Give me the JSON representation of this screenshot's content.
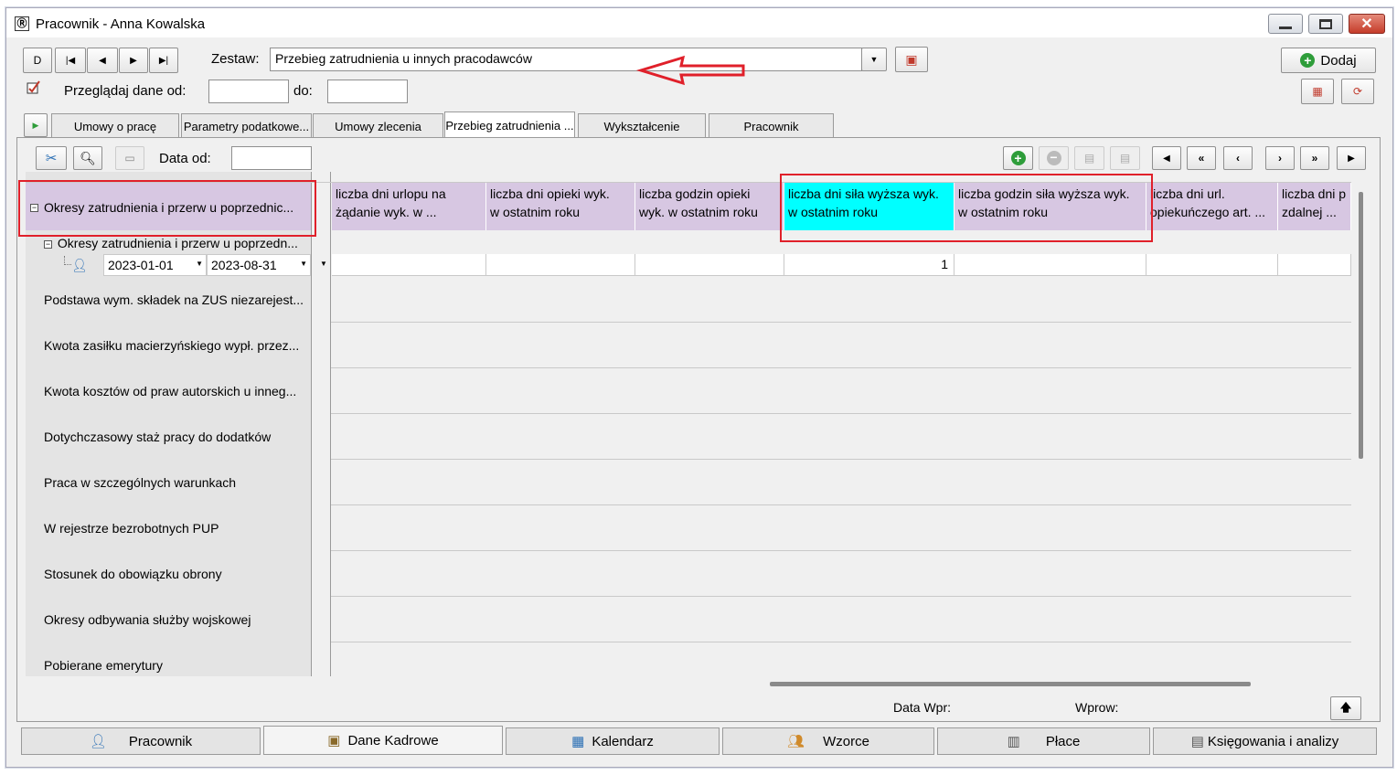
{
  "window": {
    "title": "Pracownik - Anna Kowalska"
  },
  "toolbar": {
    "nav_buttons": [
      "D",
      "|◀",
      "◀",
      "▶",
      "▶|"
    ],
    "zestaw_label": "Zestaw:",
    "zestaw_value": "Przebieg zatrudnienia u innych pracodawców",
    "add_label": "Dodaj",
    "browse_label": "Przeglądaj dane od:",
    "do_label": "do:"
  },
  "tabs": [
    "Umowy o pracę",
    "Parametry podatkowe...",
    "Umowy zlecenia",
    "Przebieg zatrudnienia ...",
    "Wykształcenie",
    "Pracownik"
  ],
  "active_tab": "Przebieg zatrudnienia ...",
  "grid": {
    "data_od_label": "Data od:",
    "group_header": "Okresy zatrudnienia i przerw u poprzednic...",
    "subgroup": "Okresy zatrudnienia i przerw u poprzedn...",
    "date_from": "2023-01-01",
    "date_to": "2023-08-31",
    "columns": [
      {
        "line1": "liczba dni urlopu na",
        "line2": "żądanie wyk. w ..."
      },
      {
        "line1": "liczba dni opieki wyk.",
        "line2": "w ostatnim roku"
      },
      {
        "line1": "liczba godzin opieki",
        "line2": "wyk. w ostatnim roku"
      },
      {
        "line1": "liczba dni siła wyższa wyk.",
        "line2": "w ostatnim roku"
      },
      {
        "line1": "liczba godzin siła wyższa wyk.",
        "line2": "w ostatnim roku"
      },
      {
        "line1": "liczba dni url.",
        "line2": "opiekuńczego art. ..."
      },
      {
        "line1": "liczba dni p",
        "line2": "zdalnej ..."
      }
    ],
    "row_values": [
      "",
      "",
      "",
      "1",
      "",
      "",
      ""
    ],
    "left_rows": [
      "Podstawa wym. składek na ZUS niezarejest...",
      "Kwota zasiłku macierzyńskiego wypł. przez...",
      "Kwota kosztów od praw autorskich u inneg...",
      "Dotychczasowy staż pracy do dodatków",
      "Praca w szczególnych warunkach",
      "W rejestrze bezrobotnych PUP",
      "Stosunek do obowiązku obrony",
      "Okresy odbywania służby wojskowej",
      "Pobierane emerytury"
    ],
    "footer_data_wpr": "Data Wpr:",
    "footer_wprow": "Wprow:"
  },
  "bottom_tabs": [
    "Pracownik",
    "Dane Kadrowe",
    "Kalendarz",
    "Wzorce",
    "Płace",
    "Księgowania i analizy"
  ],
  "colors": {
    "header_bg": "#d7c7e2",
    "highlight": "#00ffff",
    "annotation": "#e0202a"
  }
}
